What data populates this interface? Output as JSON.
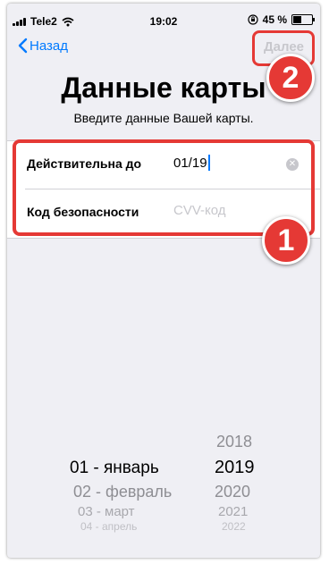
{
  "status_bar": {
    "carrier": "Tele2",
    "time": "19:02",
    "battery_percent": "45 %",
    "battery_level": 0.45
  },
  "nav": {
    "back_label": "Назад",
    "next_label": "Далее"
  },
  "header": {
    "title": "Данные карты",
    "subtitle": "Введите данные Вашей карты."
  },
  "form": {
    "expiry_label": "Действительна до",
    "expiry_value": "01/19",
    "cvv_label": "Код безопасности",
    "cvv_placeholder": "CVV-код"
  },
  "annotations": {
    "badge_1": "1",
    "badge_2": "2",
    "color": "#e53935"
  },
  "picker": {
    "months": [
      "01 - январь",
      "02 - февраль",
      "03 - март",
      "04 - апрель"
    ],
    "years": [
      "2018",
      "2019",
      "2020",
      "2021",
      "2022"
    ],
    "selected_month": "01 - январь",
    "selected_year": "2019"
  },
  "colors": {
    "accent": "#007aff",
    "disabled": "#c7c7cc",
    "background": "#efeff4"
  }
}
